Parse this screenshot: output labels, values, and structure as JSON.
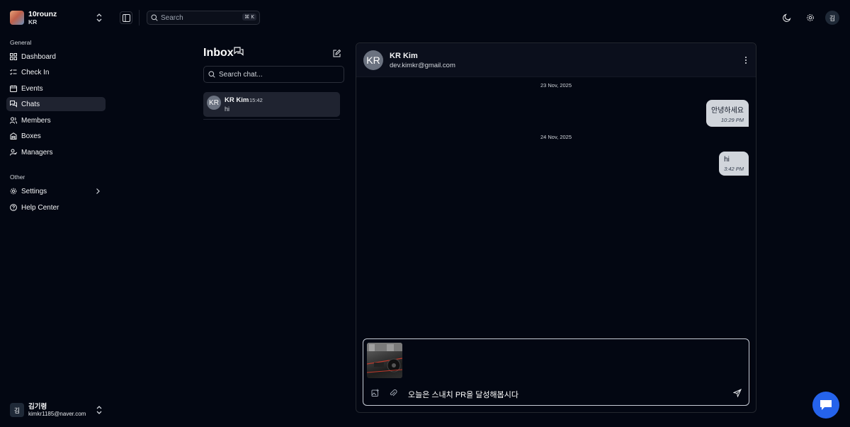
{
  "team": {
    "name": "10rounz",
    "sub": "KR"
  },
  "sidebar": {
    "general_label": "General",
    "items": [
      {
        "label": "Dashboard",
        "icon": "dashboard-icon"
      },
      {
        "label": "Check In",
        "icon": "check-list-icon"
      },
      {
        "label": "Events",
        "icon": "calendar-icon"
      },
      {
        "label": "Chats",
        "icon": "chat-icon",
        "active": true
      },
      {
        "label": "Members",
        "icon": "members-icon"
      },
      {
        "label": "Boxes",
        "icon": "box-icon"
      },
      {
        "label": "Managers",
        "icon": "manager-icon"
      }
    ],
    "other_label": "Other",
    "other_items": [
      {
        "label": "Settings",
        "icon": "gear-icon"
      },
      {
        "label": "Help Center",
        "icon": "help-icon"
      }
    ]
  },
  "user": {
    "initial": "김",
    "name": "김기령",
    "email": "kimkr1185@naver.com"
  },
  "topbar": {
    "search_placeholder": "Search",
    "shortcut": "⌘ K",
    "avatar_initial": "김"
  },
  "inbox": {
    "title": "Inbox",
    "search_placeholder": "Search chat...",
    "conversations": [
      {
        "initials": "KR",
        "name": "KR Kim",
        "time": "15:42",
        "last_message": "hi"
      }
    ]
  },
  "chat": {
    "contact": {
      "initials": "KR",
      "name": "KR Kim",
      "email": "dev.kimkr@gmail.com"
    },
    "groups": [
      {
        "date": "23 Nov, 2025",
        "messages": [
          {
            "text": "안녕하세요",
            "time": "10:29 PM"
          }
        ]
      },
      {
        "date": "24 Nov, 2025",
        "messages": [
          {
            "text": "hi",
            "time": "3:42 PM"
          }
        ]
      }
    ],
    "composer": {
      "text": "오늘은 스내치 PR을 달성해봅시다"
    }
  },
  "colors": {
    "background": "#030712",
    "active_item": "#1f2330",
    "bubble": "#d1d5db",
    "fab": "#2563eb"
  }
}
